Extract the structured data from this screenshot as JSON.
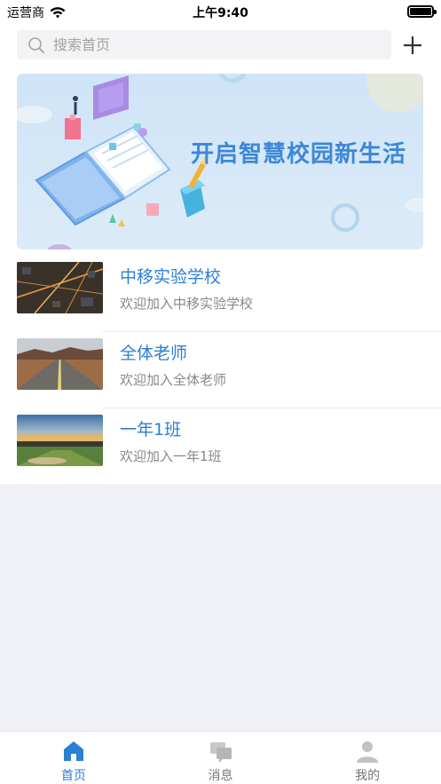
{
  "status_bar": {
    "carrier": "运营商",
    "time": "上午9:40"
  },
  "header": {
    "search_placeholder": "搜索首页",
    "search_icon": "search-icon",
    "add_icon": "plus-icon"
  },
  "banner": {
    "title": "开启智慧校园新生活"
  },
  "groups": [
    {
      "title": "中移实验学校",
      "subtitle": "欢迎加入中移实验学校",
      "thumb": "city-night-aerial"
    },
    {
      "title": "全体老师",
      "subtitle": "欢迎加入全体老师",
      "thumb": "desert-road"
    },
    {
      "title": "一年1班",
      "subtitle": "欢迎加入一年1班",
      "thumb": "sunset-field"
    }
  ],
  "tabs": [
    {
      "label": "首页",
      "icon": "home-icon",
      "active": true
    },
    {
      "label": "消息",
      "icon": "chat-icon",
      "active": false
    },
    {
      "label": "我的",
      "icon": "user-icon",
      "active": false
    }
  ],
  "colors": {
    "accent": "#2b7fd4",
    "banner_bg": "#d4e7f8",
    "page_bg": "#f0f1f6"
  }
}
